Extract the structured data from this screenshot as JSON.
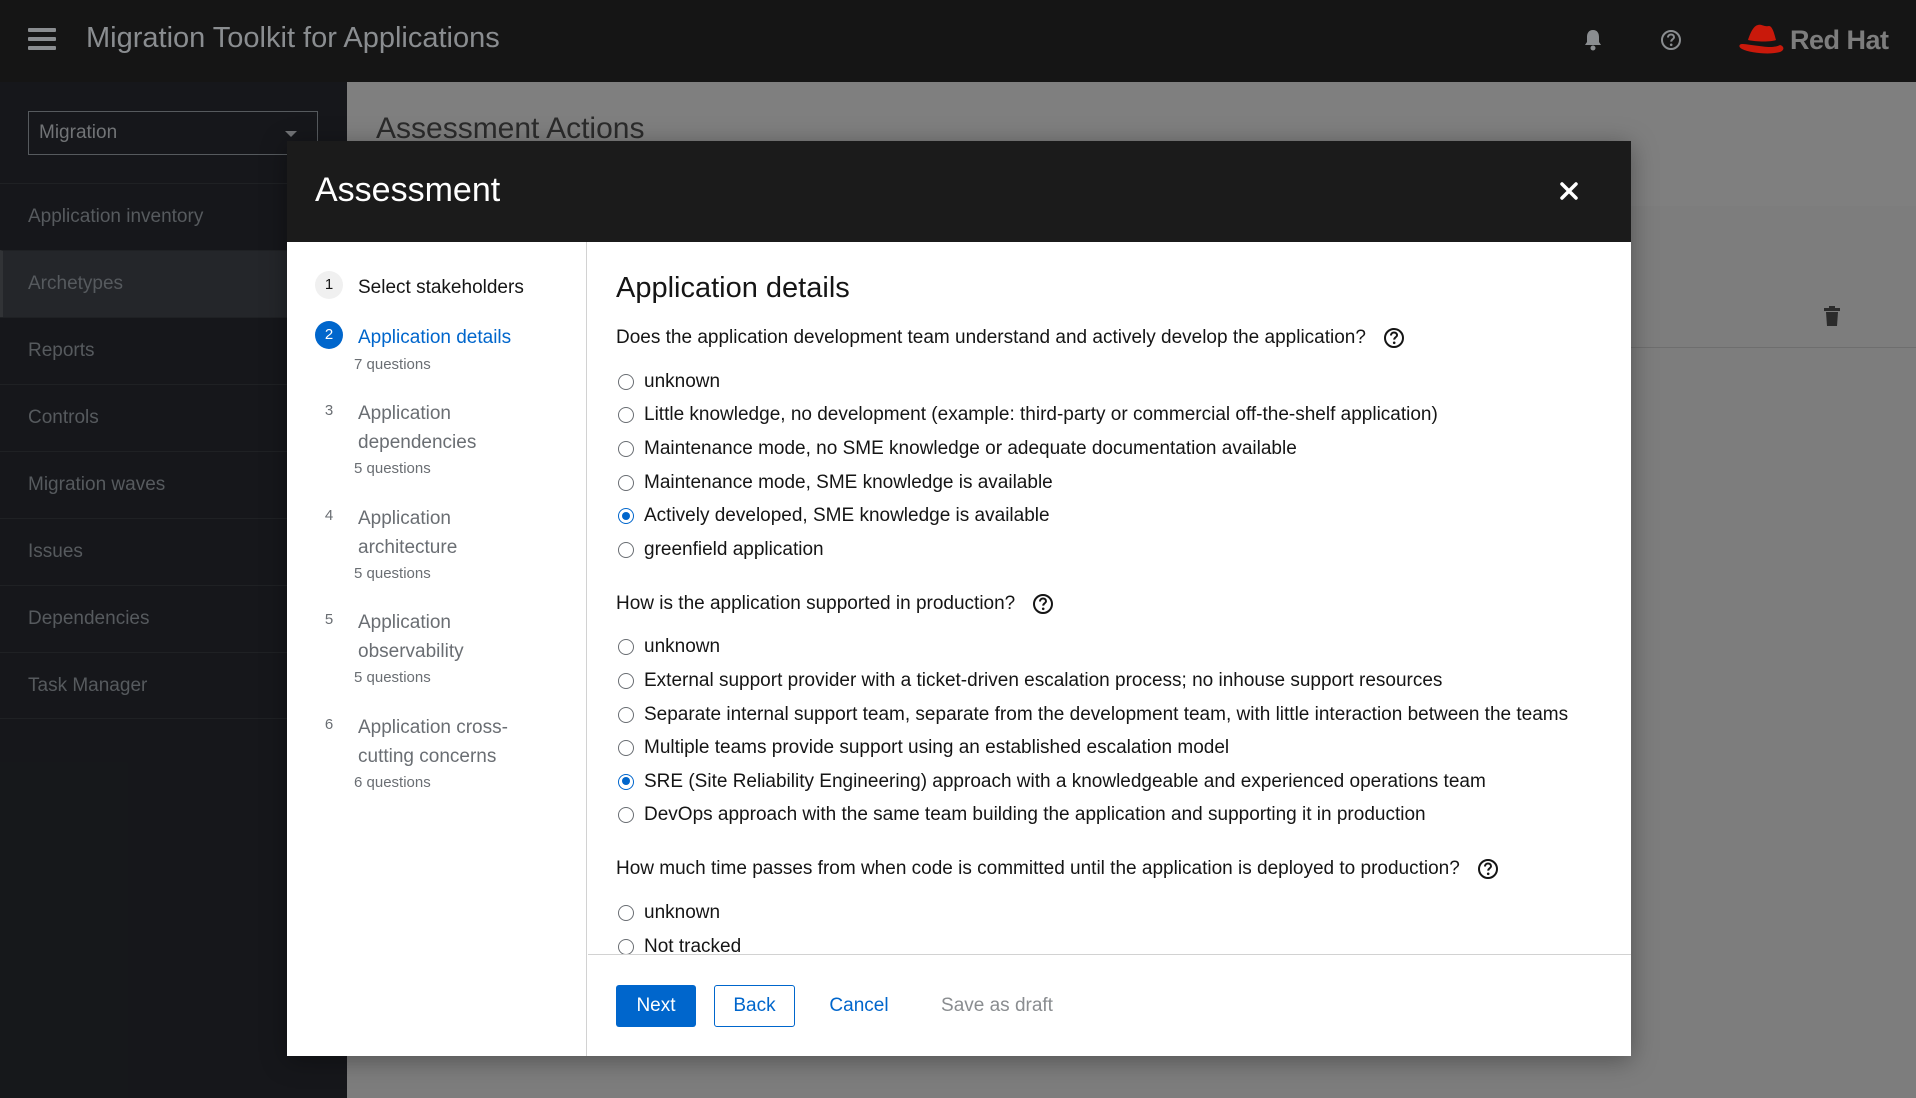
{
  "masthead": {
    "title": "Migration Toolkit for Applications",
    "brand": "Red Hat"
  },
  "sidebar": {
    "perspective": "Migration",
    "items": [
      {
        "label": "Application inventory"
      },
      {
        "label": "Archetypes"
      },
      {
        "label": "Reports"
      },
      {
        "label": "Controls"
      },
      {
        "label": "Migration waves"
      },
      {
        "label": "Issues"
      },
      {
        "label": "Dependencies"
      },
      {
        "label": "Task Manager"
      }
    ]
  },
  "page": {
    "title": "Assessment Actions"
  },
  "modal": {
    "title": "Assessment",
    "steps": [
      {
        "num": "1",
        "label": "Select stakeholders",
        "sub": ""
      },
      {
        "num": "2",
        "label": "Application details",
        "sub": "7 questions"
      },
      {
        "num": "3",
        "label": "Application dependencies",
        "sub": "5 questions"
      },
      {
        "num": "4",
        "label": "Application architecture",
        "sub": "5 questions"
      },
      {
        "num": "5",
        "label": "Application observability",
        "sub": "5 questions"
      },
      {
        "num": "6",
        "label": "Application cross-cutting concerns",
        "sub": "6 questions"
      }
    ],
    "section_title": "Application details",
    "questions": [
      {
        "text": "Does the application development team understand and actively develop the application?",
        "options": [
          "unknown",
          "Little knowledge, no development (example: third-party or commercial off-the-shelf application)",
          "Maintenance mode, no SME knowledge or adequate documentation available",
          "Maintenance mode, SME knowledge is available",
          "Actively developed, SME knowledge is available",
          "greenfield application"
        ],
        "selected": "Actively developed, SME knowledge is available"
      },
      {
        "text": "How is the application supported in production?",
        "options": [
          "unknown",
          "External support provider with a ticket-driven escalation process; no inhouse support resources",
          "Separate internal support team, separate from the development team, with little interaction between the teams",
          "Multiple teams provide support using an established escalation model",
          "SRE (Site Reliability Engineering) approach with a knowledgeable and experienced operations team",
          "DevOps approach with the same team building the application and supporting it in production"
        ],
        "selected": "SRE (Site Reliability Engineering) approach with a knowledgeable and experienced operations team"
      },
      {
        "text": "How much time passes from when code is committed until the application is deployed to production?",
        "options": [
          "unknown",
          "Not tracked"
        ],
        "selected": ""
      }
    ],
    "footer": {
      "next": "Next",
      "back": "Back",
      "cancel": "Cancel",
      "save_draft": "Save as draft"
    }
  },
  "colors": {
    "accent": "#0066cc",
    "masthead": "#151515",
    "brand_red": "#ee0000"
  }
}
